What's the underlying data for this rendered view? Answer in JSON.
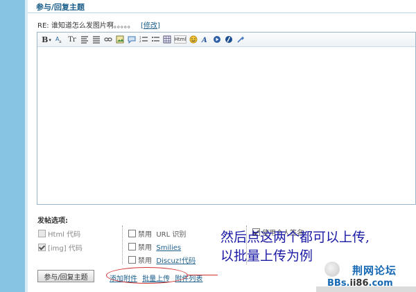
{
  "header": {
    "title": "参与/回复主题"
  },
  "subject": {
    "text": "RE: 谁知道怎么发图片啊。。。。。",
    "edit_open": "[",
    "edit_label": "修改",
    "edit_close": "]"
  },
  "toolbar": {
    "bold_label": "B",
    "font_label": "Tr",
    "html_label": "Html",
    "buttons": [
      "bold-icon",
      "font-size-icon",
      "font-family-icon",
      "align-icon",
      "list-icon",
      "link-icon",
      "image-icon",
      "quote-icon",
      "ordered-list-icon",
      "unordered-list-icon",
      "table-icon",
      "html-icon",
      "smiley-icon",
      "font-color-icon",
      "media-icon",
      "flash-icon",
      "tools-icon"
    ]
  },
  "options": {
    "title": "发帖选项:",
    "html_code": "Html 代码",
    "img_code": "[img] 代码",
    "disable": "禁用",
    "url_detect": "URL 识别",
    "smilies": "Smilies",
    "discuz_code": "Discuz!代码",
    "signature": "使用个人签名"
  },
  "submit_label": "参与/回复主题",
  "attachments": {
    "add": "添加附件",
    "batch": "批量上传",
    "list": "附件列表"
  },
  "annotation": {
    "line1": "然后点这两个都可以上传,",
    "line2": "以批量上传为例"
  },
  "watermark": {
    "title": "荆网论坛",
    "url_prefix": "BBs.",
    "url_mid": "ii86",
    "url_suffix": ".com"
  },
  "colors": {
    "sidebar": "#87c3e3",
    "link": "#1b5e8a",
    "annotation": "#1a1aa6",
    "circle": "#d03030"
  }
}
